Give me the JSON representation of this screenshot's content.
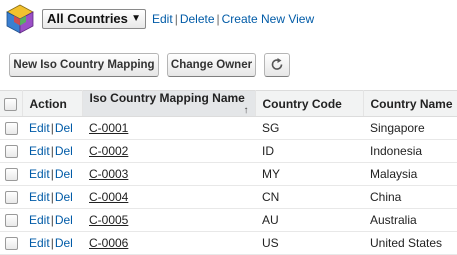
{
  "view": {
    "selected": "All Countries",
    "links": [
      "Edit",
      "Delete",
      "Create New View"
    ]
  },
  "toolbar": {
    "new_label": "New Iso Country Mapping",
    "owner_label": "Change Owner",
    "refresh_icon": "refresh-icon"
  },
  "table": {
    "columns": [
      "Action",
      "Iso Country Mapping Name",
      "Country Code",
      "Country Name"
    ],
    "sorted_column": "Iso Country Mapping Name",
    "sort_direction": "ascending",
    "action_edit": "Edit",
    "action_del": "Del",
    "rows": [
      {
        "name": "C-0001",
        "code": "SG",
        "country": "Singapore"
      },
      {
        "name": "C-0002",
        "code": "ID",
        "country": "Indonesia"
      },
      {
        "name": "C-0003",
        "code": "MY",
        "country": "Malaysia"
      },
      {
        "name": "C-0004",
        "code": "CN",
        "country": "China"
      },
      {
        "name": "C-0005",
        "code": "AU",
        "country": "Australia"
      },
      {
        "name": "C-0006",
        "code": "US",
        "country": "United States"
      }
    ]
  },
  "colors": {
    "link": "#015ba7",
    "header_bg": "#f2f3f3"
  }
}
